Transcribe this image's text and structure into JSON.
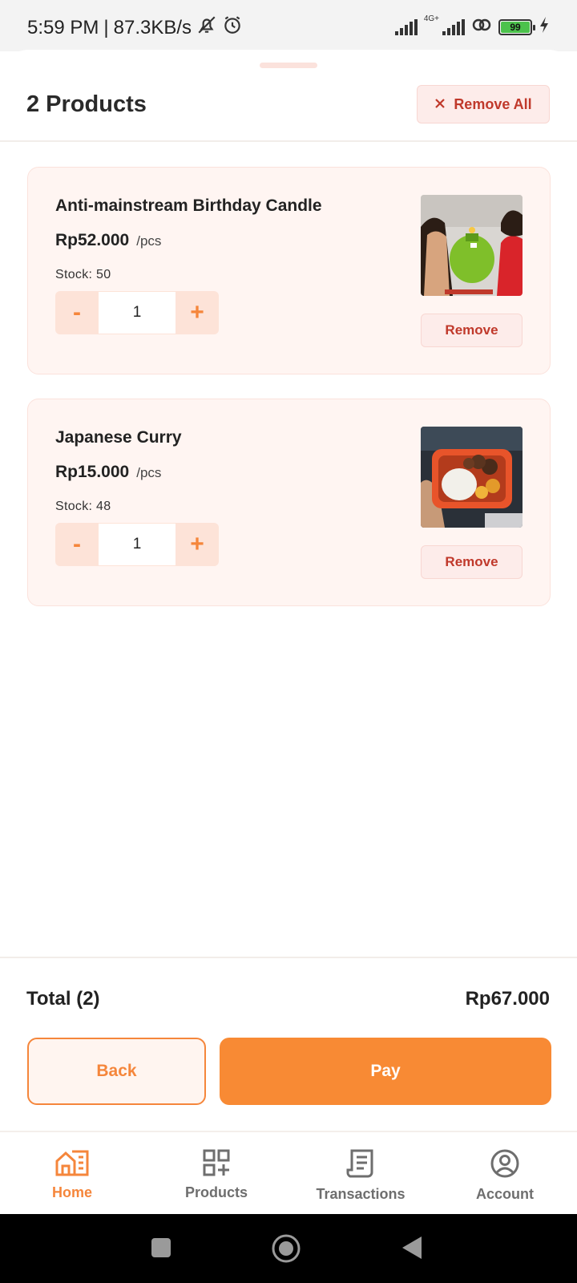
{
  "status_bar": {
    "time": "5:59 PM",
    "separator": "|",
    "net_speed": "87.3KB/s",
    "network_type": "4G+",
    "battery": "99",
    "icons": [
      "bell-off-icon",
      "alarm-icon",
      "signal-icon",
      "signal-4g-icon",
      "sync-icon",
      "battery-icon",
      "charging-icon"
    ]
  },
  "header": {
    "title": "2 Products",
    "remove_all_label": "Remove All",
    "remove_all_icon": "close-icon"
  },
  "products": [
    {
      "name": "Anti-mainstream Birthday Candle",
      "price": "Rp52.000",
      "unit": "/pcs",
      "stock": "Stock: 50",
      "quantity": "1",
      "decrement_label": "-",
      "increment_label": "+",
      "remove_label": "Remove"
    },
    {
      "name": "Japanese Curry",
      "price": "Rp15.000",
      "unit": "/pcs",
      "stock": "Stock: 48",
      "quantity": "1",
      "decrement_label": "-",
      "increment_label": "+",
      "remove_label": "Remove"
    }
  ],
  "summary": {
    "total_label": "Total (2)",
    "total_value": "Rp67.000",
    "back_label": "Back",
    "pay_label": "Pay"
  },
  "bottom_nav": {
    "items": [
      {
        "label": "Home",
        "icon": "home-icon",
        "active": true
      },
      {
        "label": "Products",
        "icon": "products-grid-icon",
        "active": false
      },
      {
        "label": "Transactions",
        "icon": "receipt-icon",
        "active": false
      },
      {
        "label": "Account",
        "icon": "account-icon",
        "active": false
      }
    ]
  },
  "colors": {
    "accent": "#f88a34",
    "danger": "#c0392b",
    "card_bg": "#fff5f2",
    "inactive_nav": "#6e6e6e"
  }
}
